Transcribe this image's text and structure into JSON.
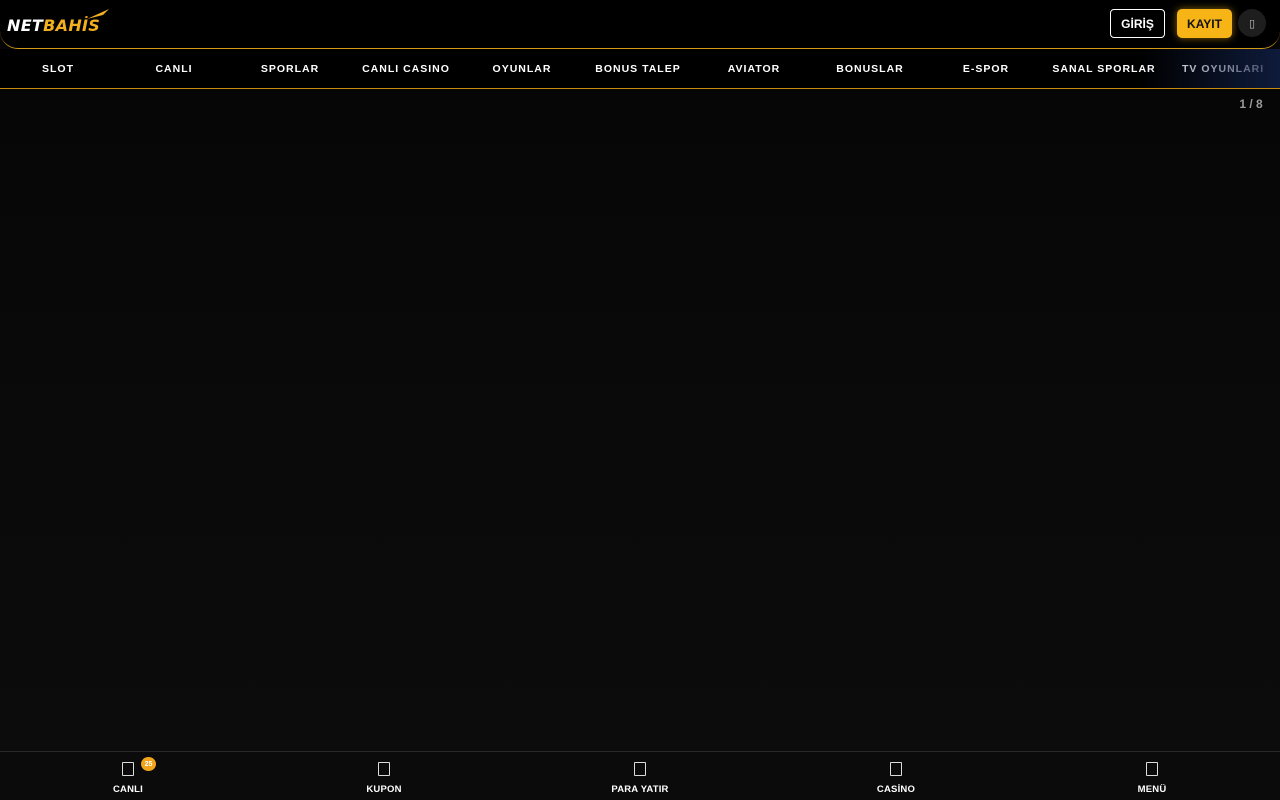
{
  "brand": {
    "logo_part1": "NET",
    "logo_part2": "BAHİS",
    "accent_color": "#f6b416",
    "logo_icon": "swoosh-icon"
  },
  "header": {
    "login_label": "GİRİŞ",
    "register_label": "KAYIT",
    "language_icon": "globe-icon",
    "language_glyph": "▯"
  },
  "nav": {
    "items": [
      {
        "label": "SLOT"
      },
      {
        "label": "CANLI"
      },
      {
        "label": "SPORLAR"
      },
      {
        "label": "CANLI CASINO"
      },
      {
        "label": "OYUNLAR"
      },
      {
        "label": "BONUS TALEP"
      },
      {
        "label": "AVIATOR"
      },
      {
        "label": "BONUSLAR"
      },
      {
        "label": "E-SPOR"
      },
      {
        "label": "SANAL SPORLAR"
      },
      {
        "label": "TV OYUNLARI"
      }
    ]
  },
  "slider": {
    "counter": "1 / 8"
  },
  "bottom_bar": {
    "items": [
      {
        "label": "CANLI",
        "icon": "live-icon"
      },
      {
        "label": "KUPON",
        "icon": "coupon-icon"
      },
      {
        "label": "PARA YATIR",
        "icon": "deposit-icon"
      },
      {
        "label": "CASİNO",
        "icon": "casino-icon"
      },
      {
        "label": "MENÜ",
        "icon": "menu-icon"
      }
    ],
    "live_badge": "25"
  }
}
